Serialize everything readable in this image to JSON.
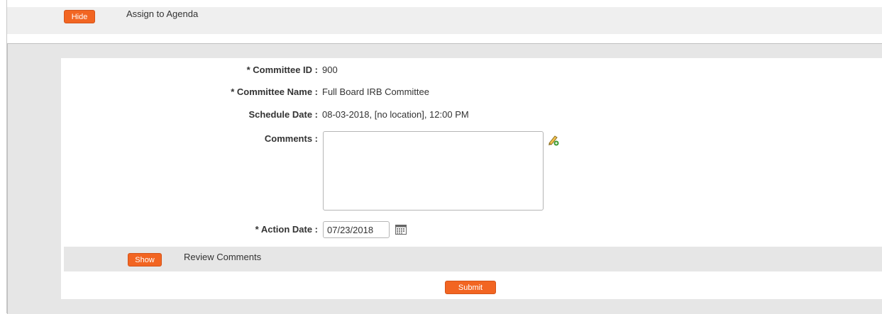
{
  "assign_section": {
    "hide_label": "Hide",
    "title": "Assign to Agenda"
  },
  "form": {
    "committee_id": {
      "label": "* Committee ID :",
      "value": "900"
    },
    "committee_name": {
      "label": "* Committee Name :",
      "value": "Full Board IRB Committee"
    },
    "schedule_date": {
      "label": "Schedule Date :",
      "value": "08-03-2018, [no location], 12:00 PM"
    },
    "comments": {
      "label": "Comments :",
      "value": ""
    },
    "action_date": {
      "label": "* Action Date :",
      "value": "07/23/2018"
    }
  },
  "review_section": {
    "show_label": "Show",
    "title": "Review Comments"
  },
  "submit_label": "Submit",
  "icons": {
    "edit": "pencil-edit-icon",
    "calendar": "calendar-icon"
  },
  "colors": {
    "accent": "#f26522",
    "bar_background": "#efefef",
    "panel_background": "#e6e6e6"
  }
}
